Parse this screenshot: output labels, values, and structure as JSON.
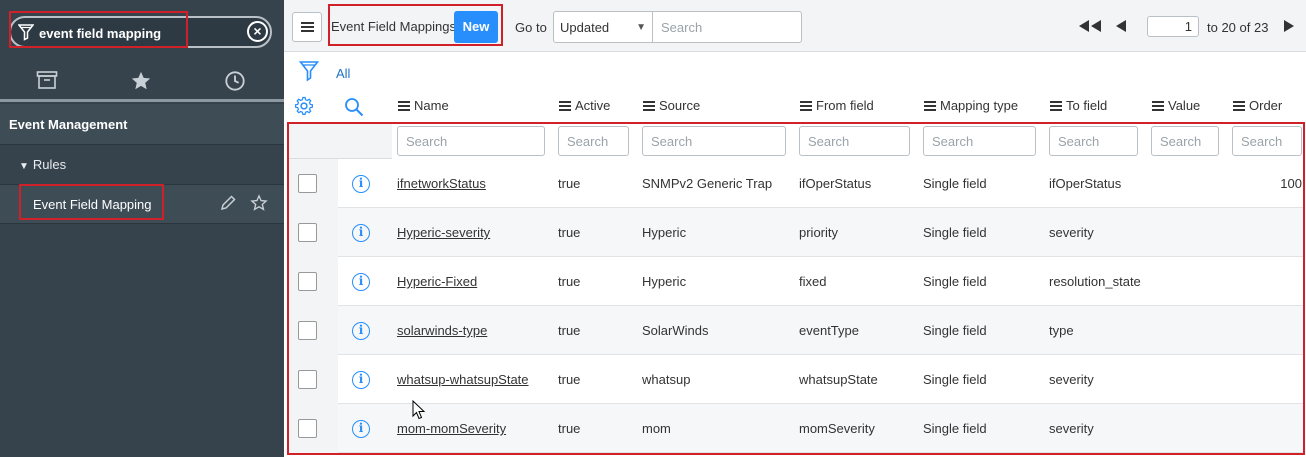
{
  "sidebar": {
    "filter_value": "event field mapping",
    "tabs": [
      {
        "name": "archive-icon"
      },
      {
        "name": "star-icon"
      },
      {
        "name": "clock-icon"
      }
    ],
    "app_label": "Event Management",
    "section_label": "Rules",
    "module_label": "Event Field Mapping"
  },
  "header": {
    "title": "Event Field Mappings",
    "new_label": "New",
    "goto_label": "Go to",
    "goto_selected": "Updated",
    "search_placeholder": "Search",
    "page_value": "1",
    "page_range": "to 20 of 23"
  },
  "breadcrumb": {
    "all_label": "All"
  },
  "columns": [
    "Name",
    "Active",
    "Source",
    "From field",
    "Mapping type",
    "To field",
    "Value",
    "Order"
  ],
  "column_search_placeholder": "Search",
  "rows": [
    {
      "name": "ifnetworkStatus",
      "active": "true",
      "source": "SNMPv2 Generic Trap",
      "from_field": "ifOperStatus",
      "mapping_type": "Single field",
      "to_field": "ifOperStatus",
      "value": "",
      "order": "100"
    },
    {
      "name": "Hyperic-severity",
      "active": "true",
      "source": "Hyperic",
      "from_field": "priority",
      "mapping_type": "Single field",
      "to_field": "severity",
      "value": "",
      "order": ""
    },
    {
      "name": "Hyperic-Fixed",
      "active": "true",
      "source": "Hyperic",
      "from_field": "fixed",
      "mapping_type": "Single field",
      "to_field": "resolution_state",
      "value": "",
      "order": ""
    },
    {
      "name": "solarwinds-type",
      "active": "true",
      "source": "SolarWinds",
      "from_field": "eventType",
      "mapping_type": "Single field",
      "to_field": "type",
      "value": "",
      "order": ""
    },
    {
      "name": "whatsup-whatsupState",
      "active": "true",
      "source": "whatsup",
      "from_field": "whatsupState",
      "mapping_type": "Single field",
      "to_field": "severity",
      "value": "",
      "order": ""
    },
    {
      "name": "mom-momSeverity",
      "active": "true",
      "source": "mom",
      "from_field": "momSeverity",
      "mapping_type": "Single field",
      "to_field": "severity",
      "value": "",
      "order": ""
    }
  ],
  "colors": {
    "sidebar_bg": "#36434d",
    "accent_blue": "#278efc",
    "highlight_red": "#d0202a"
  }
}
